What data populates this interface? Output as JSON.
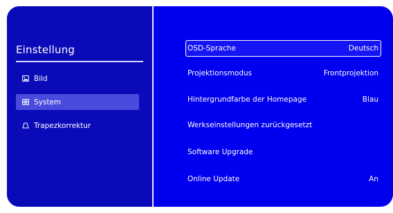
{
  "sidebar": {
    "title": "Einstellung",
    "items": [
      {
        "icon": "image-icon",
        "label": "Bild"
      },
      {
        "icon": "grid-icon",
        "label": "System"
      },
      {
        "icon": "trapezoid-icon",
        "label": "Trapezkorrektur"
      }
    ]
  },
  "menu": {
    "items": [
      {
        "label": "OSD-Sprache",
        "value": "Deutsch"
      },
      {
        "label": "Projektionsmodus",
        "value": "Frontprojektion"
      },
      {
        "label": "Hintergrundfarbe der Homepage",
        "value": "Blau"
      },
      {
        "label": "Werkseinstellungen zurückgesetzt",
        "value": ""
      },
      {
        "label": "Software Upgrade",
        "value": ""
      },
      {
        "label": "Online Update",
        "value": "An"
      }
    ]
  },
  "colors": {
    "background": "#0000ee",
    "sidebar": "#0a0ab8",
    "active_item": "#4a4adf",
    "text": "#ffffff"
  }
}
